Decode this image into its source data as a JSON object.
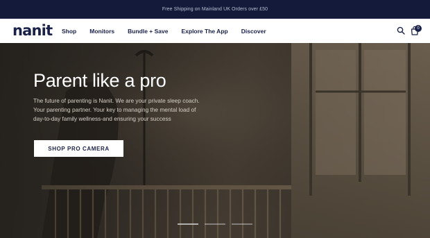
{
  "announcement": "Free Shipping on Mainland UK Orders over £50",
  "logo": "nanit",
  "nav": [
    "Shop",
    "Monitors",
    "Bundle + Save",
    "Explore The App",
    "Discover"
  ],
  "cart": {
    "count": "0"
  },
  "icons": {
    "search": "search-icon",
    "cart": "cart-icon"
  },
  "hero": {
    "title": "Parent like a pro",
    "text": "The future of parenting is Nanit. We are your private sleep coach. Your parenting partner. Your key to managing the mental load of day-to-day family wellness-and ensuring your success",
    "cta": "SHOP PRO CAMERA"
  },
  "slider": {
    "count": 3,
    "active": 0
  },
  "colors": {
    "brand_navy": "#1a2148",
    "announcement_bg": "#131a3a",
    "white": "#ffffff"
  }
}
